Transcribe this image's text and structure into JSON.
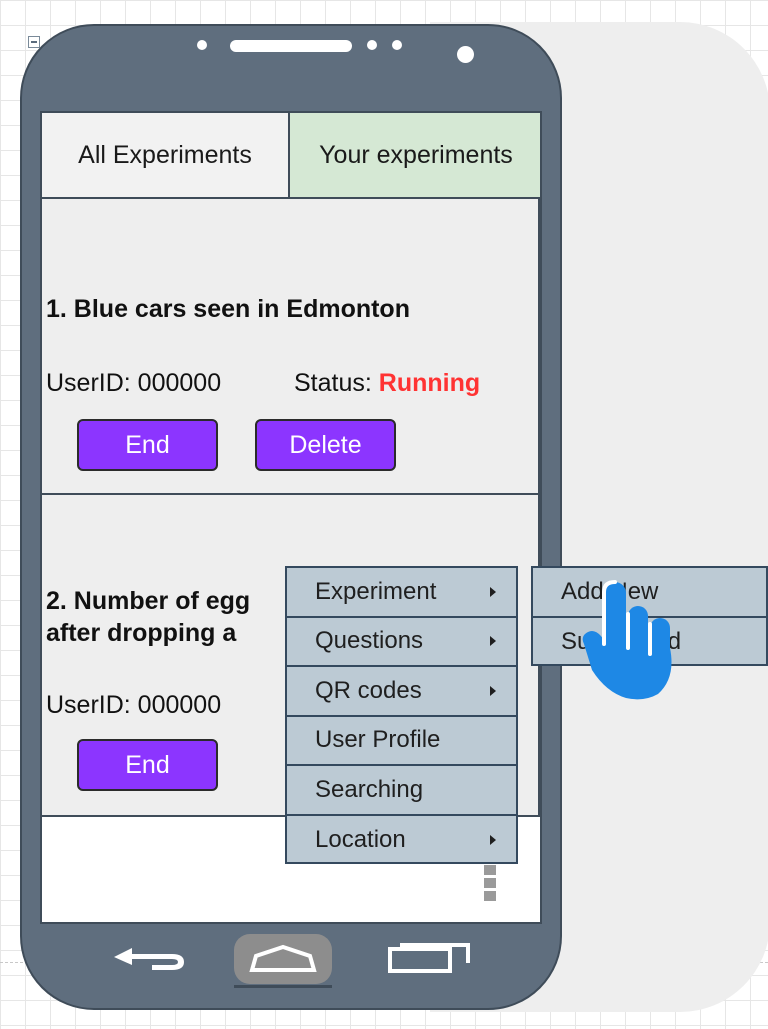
{
  "tabs": [
    {
      "label": "All Experiments"
    },
    {
      "label": "Your experiments"
    }
  ],
  "experiments": [
    {
      "title_lines": [
        "1. Blue cars seen in Edmonton"
      ],
      "user_id": "UserID: 000000",
      "status_label": "Status:",
      "status_value": "Running",
      "buttons": [
        "End",
        "Delete"
      ]
    },
    {
      "title_lines": [
        "2. Number of egg",
        "after dropping a"
      ],
      "user_id": "UserID: 000000",
      "buttons": [
        "End"
      ]
    }
  ],
  "context_menu": {
    "items": [
      {
        "label": "Experiment",
        "submenu": true
      },
      {
        "label": "Questions",
        "submenu": true
      },
      {
        "label": "QR codes",
        "submenu": true
      },
      {
        "label": "User Profile",
        "submenu": false
      },
      {
        "label": "Searching",
        "submenu": false
      },
      {
        "label": "Location",
        "submenu": true
      }
    ]
  },
  "submenu": {
    "items": [
      {
        "label": "Add New"
      },
      {
        "label": "Subscribed"
      }
    ]
  },
  "colors": {
    "phone_body": "#5f6e7e",
    "selected_tab": "#d5e8d4",
    "button": "#8c35ff",
    "status_running": "#ff3333",
    "menu_bg": "#bccad4",
    "cursor_hand": "#1e88e5"
  }
}
